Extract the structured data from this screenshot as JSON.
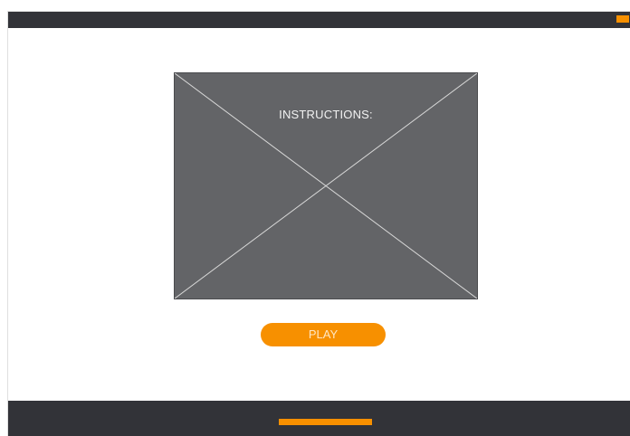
{
  "screen": {
    "instructions_text": "INSTRUCTIONS:",
    "play_label": "PLAY"
  },
  "colors": {
    "accent": "#f79000",
    "bar": "#323338",
    "placeholder": "#636467"
  },
  "icons": {
    "image_placeholder": "image-placeholder-icon"
  }
}
